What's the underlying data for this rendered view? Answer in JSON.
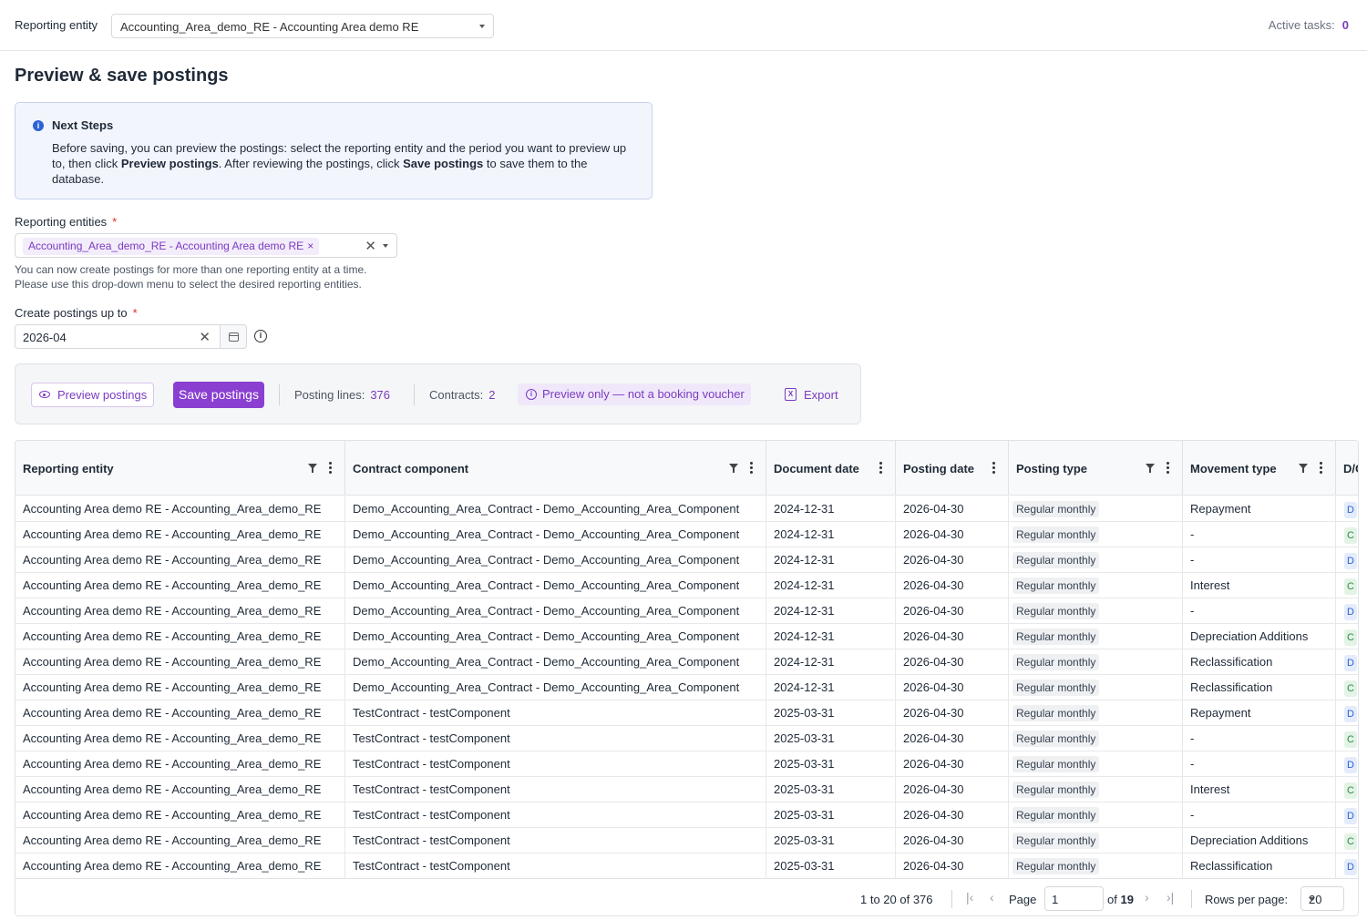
{
  "topbar": {
    "reporting_entity_label": "Reporting entity",
    "reporting_entity_value": "Accounting_Area_demo_RE - Accounting Area demo RE",
    "active_tasks_label": "Active tasks:",
    "active_tasks_count": "0"
  },
  "page": {
    "title": "Preview & save postings"
  },
  "info": {
    "heading": "Next Steps",
    "body_1": "Before saving, you can preview the postings: select the reporting entity and the period you want to preview up to, then click ",
    "body_bold_1": "Preview postings",
    "body_2": ". After reviewing the postings, click ",
    "body_bold_2": "Save postings",
    "body_3": " to save them to the database."
  },
  "form": {
    "entities_label": "Reporting entities",
    "required_mark": "*",
    "entities_chip": "Accounting_Area_demo_RE - Accounting Area demo RE",
    "entities_hint_1": "You can now create postings for more than one reporting entity at a time.",
    "entities_hint_2": "Please use this drop-down menu to select the desired reporting entities.",
    "upto_label": "Create postings up to",
    "upto_value": "2026-04"
  },
  "toolbar": {
    "preview_label": "Preview postings",
    "save_label": "Save postings",
    "posting_lines_label": "Posting lines:",
    "posting_lines_value": "376",
    "contracts_label": "Contracts:",
    "contracts_value": "2",
    "preview_only_label": "Preview only — not a booking voucher",
    "export_label": "Export"
  },
  "grid": {
    "columns": [
      "Reporting entity",
      "Contract component",
      "Document date",
      "Posting date",
      "Posting type",
      "Movement type",
      "D/C"
    ],
    "rows": [
      [
        "Accounting Area demo RE - Accounting_Area_demo_RE",
        "Demo_Accounting_Area_Contract - Demo_Accounting_Area_Component",
        "2024-12-31",
        "2026-04-30",
        "Regular monthly",
        "Repayment",
        "D"
      ],
      [
        "Accounting Area demo RE - Accounting_Area_demo_RE",
        "Demo_Accounting_Area_Contract - Demo_Accounting_Area_Component",
        "2024-12-31",
        "2026-04-30",
        "Regular monthly",
        "-",
        "C"
      ],
      [
        "Accounting Area demo RE - Accounting_Area_demo_RE",
        "Demo_Accounting_Area_Contract - Demo_Accounting_Area_Component",
        "2024-12-31",
        "2026-04-30",
        "Regular monthly",
        "-",
        "D"
      ],
      [
        "Accounting Area demo RE - Accounting_Area_demo_RE",
        "Demo_Accounting_Area_Contract - Demo_Accounting_Area_Component",
        "2024-12-31",
        "2026-04-30",
        "Regular monthly",
        "Interest",
        "C"
      ],
      [
        "Accounting Area demo RE - Accounting_Area_demo_RE",
        "Demo_Accounting_Area_Contract - Demo_Accounting_Area_Component",
        "2024-12-31",
        "2026-04-30",
        "Regular monthly",
        "-",
        "D"
      ],
      [
        "Accounting Area demo RE - Accounting_Area_demo_RE",
        "Demo_Accounting_Area_Contract - Demo_Accounting_Area_Component",
        "2024-12-31",
        "2026-04-30",
        "Regular monthly",
        "Depreciation Additions",
        "C"
      ],
      [
        "Accounting Area demo RE - Accounting_Area_demo_RE",
        "Demo_Accounting_Area_Contract - Demo_Accounting_Area_Component",
        "2024-12-31",
        "2026-04-30",
        "Regular monthly",
        "Reclassification",
        "D"
      ],
      [
        "Accounting Area demo RE - Accounting_Area_demo_RE",
        "Demo_Accounting_Area_Contract - Demo_Accounting_Area_Component",
        "2024-12-31",
        "2026-04-30",
        "Regular monthly",
        "Reclassification",
        "C"
      ],
      [
        "Accounting Area demo RE - Accounting_Area_demo_RE",
        "TestContract - testComponent",
        "2025-03-31",
        "2026-04-30",
        "Regular monthly",
        "Repayment",
        "D"
      ],
      [
        "Accounting Area demo RE - Accounting_Area_demo_RE",
        "TestContract - testComponent",
        "2025-03-31",
        "2026-04-30",
        "Regular monthly",
        "-",
        "C"
      ],
      [
        "Accounting Area demo RE - Accounting_Area_demo_RE",
        "TestContract - testComponent",
        "2025-03-31",
        "2026-04-30",
        "Regular monthly",
        "-",
        "D"
      ],
      [
        "Accounting Area demo RE - Accounting_Area_demo_RE",
        "TestContract - testComponent",
        "2025-03-31",
        "2026-04-30",
        "Regular monthly",
        "Interest",
        "C"
      ],
      [
        "Accounting Area demo RE - Accounting_Area_demo_RE",
        "TestContract - testComponent",
        "2025-03-31",
        "2026-04-30",
        "Regular monthly",
        "-",
        "D"
      ],
      [
        "Accounting Area demo RE - Accounting_Area_demo_RE",
        "TestContract - testComponent",
        "2025-03-31",
        "2026-04-30",
        "Regular monthly",
        "Depreciation Additions",
        "C"
      ],
      [
        "Accounting Area demo RE - Accounting_Area_demo_RE",
        "TestContract - testComponent",
        "2025-03-31",
        "2026-04-30",
        "Regular monthly",
        "Reclassification",
        "D"
      ]
    ]
  },
  "pagination": {
    "range": "1 to 20 of 376",
    "page_label": "Page",
    "page_value": "1",
    "of_label": "of",
    "total_pages": "19",
    "rows_per_page_label": "Rows per page:",
    "rows_per_page_value": "20"
  },
  "colors": {
    "accent": "#8a3fd1",
    "info_blue": "#2d62d6",
    "debit": "#2d62d6",
    "credit": "#2e8b47"
  }
}
